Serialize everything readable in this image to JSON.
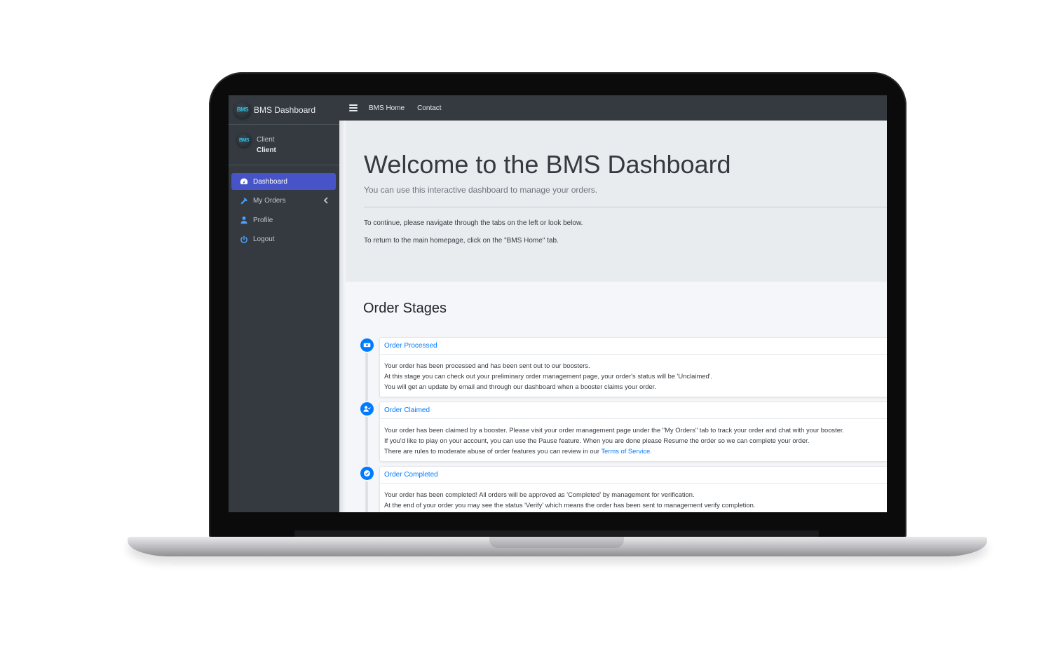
{
  "sidebar": {
    "brand": "BMS Dashboard",
    "logo_text": "BMS",
    "user": {
      "name": "Client",
      "role": "Client"
    },
    "items": [
      {
        "label": "Dashboard",
        "icon": "tachometer-icon",
        "active": true
      },
      {
        "label": "My Orders",
        "icon": "hammer-icon"
      },
      {
        "label": "Profile",
        "icon": "user-icon"
      },
      {
        "label": "Logout",
        "icon": "power-icon"
      }
    ]
  },
  "topbar": {
    "links": [
      "BMS Home",
      "Contact"
    ]
  },
  "hero": {
    "title": "Welcome to the BMS Dashboard",
    "lead": "You can use this interactive dashboard to manage your orders.",
    "p1": "To continue, please navigate through the tabs on the left or look below.",
    "p2": "To return to the main homepage, click on the \"BMS Home\" tab."
  },
  "stages": {
    "title": "Order Stages",
    "items": [
      {
        "title": "Order Processed",
        "lines": [
          "Your order has been processed and has been sent out to our boosters.",
          "At this stage you can check out your preliminary order management page, your order's status will be 'Unclaimed'.",
          "You will get an update by email and through our dashboard when a booster claims your order."
        ]
      },
      {
        "title": "Order Claimed",
        "lines": [
          "Your order has been claimed by a booster. Please visit your order management page under the \"My Orders\" tab to track your order and chat with your booster.",
          "If you'd like to play on your account, you can use the Pause feature. When you are done please Resume the order so we can complete your order.",
          "There are rules to moderate abuse of order features you can review in our "
        ],
        "link": "Terms of Service."
      },
      {
        "title": "Order Completed",
        "lines": [
          "Your order has been completed! All orders will be approved as 'Completed' by management for verification.",
          "At the end of your order you may see the status 'Verify' which means the order has been sent to management verify completion."
        ]
      }
    ]
  },
  "colors": {
    "sidebar_bg": "#343a40",
    "active_nav": "#4754c8",
    "accent": "#007bff",
    "jumbotron_bg": "#e9ecef"
  }
}
